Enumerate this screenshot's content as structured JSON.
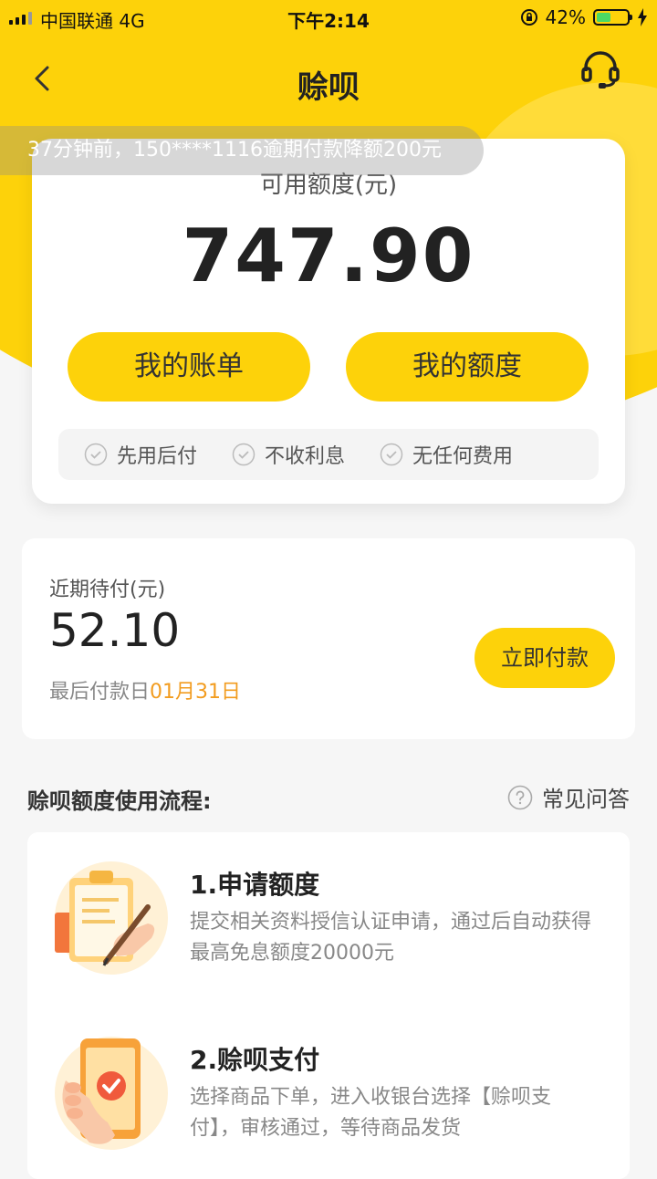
{
  "status_bar": {
    "carrier": "中国联通  4G",
    "time": "下午2:14",
    "battery": "42%"
  },
  "nav": {
    "title": "赊呗"
  },
  "notice": "37分钟前，150****1116逾期付款降额200元",
  "credit": {
    "label": "可用额度(元)",
    "amount": "747.90",
    "bill_button": "我的账单",
    "limit_button": "我的额度",
    "features": [
      "先用后付",
      "不收利息",
      "无任何费用"
    ]
  },
  "recent": {
    "label": "近期待付(元)",
    "amount": "52.10",
    "due_prefix": "最后付款日",
    "due_date": "01月31日",
    "pay_button": "立即付款"
  },
  "process": {
    "title": "赊呗额度使用流程:",
    "faq": "常见问答",
    "steps": [
      {
        "title": "1.申请额度",
        "desc": "提交相关资料授信认证申请，通过后自动获得最高免息额度20000元"
      },
      {
        "title": "2.赊呗支付",
        "desc": "选择商品下单，进入收银台选择【赊呗支付】，审核通过，等待商品发货"
      }
    ]
  },
  "colors": {
    "brand_yellow": "#fdd20a",
    "due_date_orange": "#f29c1f"
  }
}
